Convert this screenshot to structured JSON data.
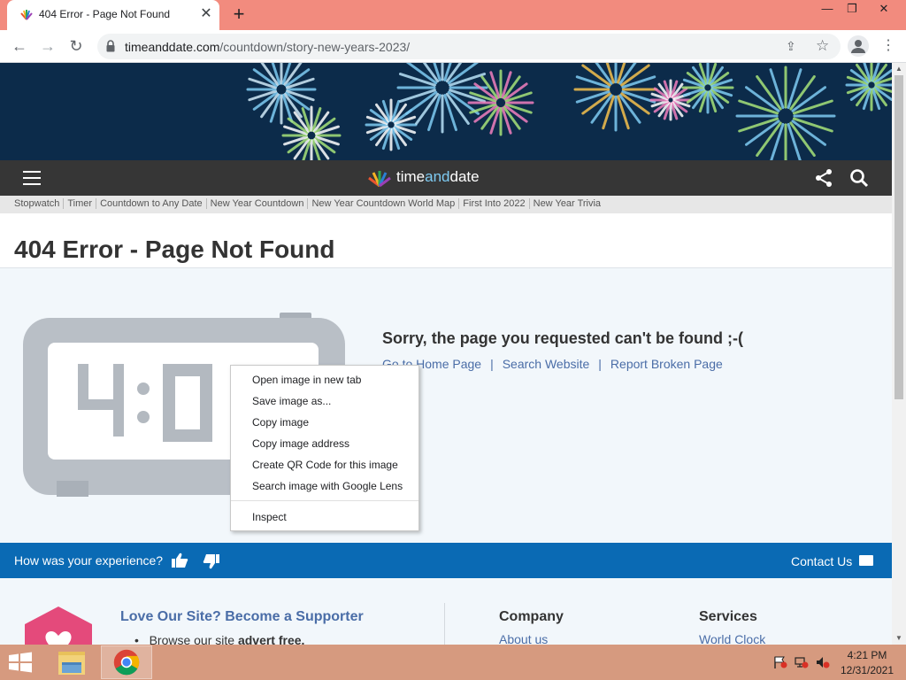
{
  "browser": {
    "tab": {
      "title": "404 Error - Page Not Found",
      "close_glyph": "✕"
    },
    "new_tab_glyph": "+",
    "window_controls": {
      "minimize": "—",
      "restore": "❐",
      "close": "✕"
    },
    "nav": {
      "back_glyph": "←",
      "forward_glyph": "→",
      "reload_glyph": "↻"
    },
    "address": {
      "host": "timeanddate.com",
      "path": "/countdown/story-new-years-2023/"
    },
    "menu_glyph": "⋮"
  },
  "site": {
    "logo": {
      "part1": "time",
      "part2": "and",
      "part3": "date"
    },
    "subnav": [
      "Stopwatch",
      "Timer",
      "Countdown to Any Date",
      "New Year Countdown",
      "New Year Countdown World Map",
      "First Into 2022",
      "New Year Trivia"
    ],
    "page_title": "404 Error - Page Not Found",
    "sorry_message": "Sorry, the page you requested can't be found ;-(",
    "links": {
      "home": "Go to Home Page",
      "search": "Search Website",
      "report": "Report Broken Page",
      "separator": "|"
    },
    "feedback": {
      "question": "How was your experience?",
      "contact": "Contact Us"
    },
    "footer": {
      "supporter_title": "Love Our Site? Become a Supporter",
      "supporter_bullet_prefix": "Browse our site ",
      "supporter_bullet_bold": "advert free.",
      "company_title": "Company",
      "company_link": "About us",
      "services_title": "Services",
      "services_link": "World Clock"
    }
  },
  "context_menu": {
    "items": [
      "Open image in new tab",
      "Save image as...",
      "Copy image",
      "Copy image address",
      "Create QR Code for this image",
      "Search image with Google Lens"
    ],
    "inspect": "Inspect"
  },
  "taskbar": {
    "time": "4:21 PM",
    "date": "12/31/2021"
  },
  "colors": {
    "titlebar": "#f28b7e",
    "banner": "#0c2b4a",
    "navbar": "#363636",
    "feedback_bar": "#0a6ab4",
    "link": "#4a6da7",
    "taskbar": "#d69a7f"
  }
}
